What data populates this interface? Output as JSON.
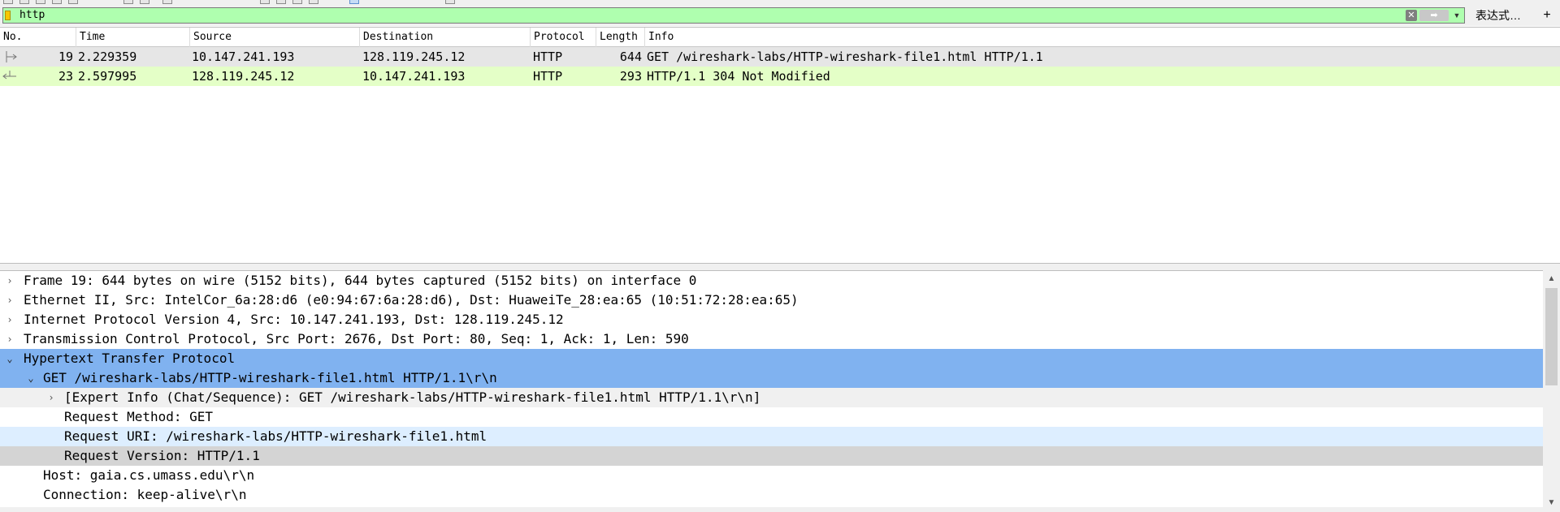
{
  "filter": {
    "value": "http",
    "clear_icon": "clear-icon",
    "apply_icon": "arrow-right-icon",
    "expression_label": "表达式…",
    "add_label": "+"
  },
  "packet_list": {
    "columns": [
      "No.",
      "Time",
      "Source",
      "Destination",
      "Protocol",
      "Length",
      "Info"
    ],
    "rows": [
      {
        "no": "19",
        "time": "2.229359",
        "source": "10.147.241.193",
        "destination": "128.119.245.12",
        "protocol": "HTTP",
        "length": "644",
        "info": "GET /wireshark-labs/HTTP-wireshark-file1.html HTTP/1.1"
      },
      {
        "no": "23",
        "time": "2.597995",
        "source": "128.119.245.12",
        "destination": "10.147.241.193",
        "protocol": "HTTP",
        "length": "293",
        "info": "HTTP/1.1 304 Not Modified"
      }
    ]
  },
  "details": {
    "lines": [
      "Frame 19: 644 bytes on wire (5152 bits), 644 bytes captured (5152 bits) on interface 0",
      "Ethernet II, Src: IntelCor_6a:28:d6 (e0:94:67:6a:28:d6), Dst: HuaweiTe_28:ea:65 (10:51:72:28:ea:65)",
      "Internet Protocol Version 4, Src: 10.147.241.193, Dst: 128.119.245.12",
      "Transmission Control Protocol, Src Port: 2676, Dst Port: 80, Seq: 1, Ack: 1, Len: 590",
      "Hypertext Transfer Protocol",
      "GET /wireshark-labs/HTTP-wireshark-file1.html HTTP/1.1\\r\\n",
      "[Expert Info (Chat/Sequence): GET /wireshark-labs/HTTP-wireshark-file1.html HTTP/1.1\\r\\n]",
      "Request Method: GET",
      "Request URI: /wireshark-labs/HTTP-wireshark-file1.html",
      "Request Version: HTTP/1.1",
      "Host: gaia.cs.umass.edu\\r\\n",
      "Connection: keep-alive\\r\\n"
    ]
  },
  "colors": {
    "filter_valid": "#afffaf",
    "row_selected": "#e6e6e6",
    "row_http": "#e4ffc7",
    "tree_selected": "#80b2f0"
  }
}
